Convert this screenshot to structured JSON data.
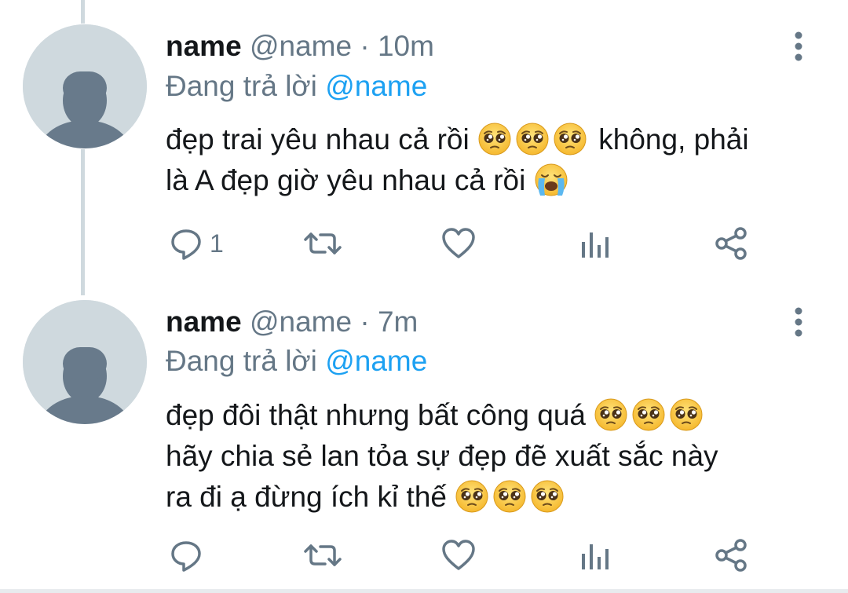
{
  "tweets": [
    {
      "name": "name",
      "handle": "@name",
      "separator": "·",
      "time": "10m",
      "reply_prefix": "Đang trả lời",
      "reply_to": "@name",
      "line1_a": "đẹp trai yêu nhau cả rồi",
      "line1_b": "không, phải",
      "line2": "là A đẹp giờ yêu nhau cả rồi",
      "reply_count": "1"
    },
    {
      "name": "name",
      "handle": "@name",
      "separator": "·",
      "time": "7m",
      "reply_prefix": "Đang trả lời",
      "reply_to": "@name",
      "line1": "đẹp đôi thật nhưng bất công quá",
      "line2": "hãy chia sẻ lan tỏa sự đẹp đẽ xuất sắc này",
      "line3": "ra đi ạ đừng ích kỉ thế",
      "reply_count": ""
    }
  ],
  "icons": {
    "reply": "reply-icon",
    "retweet": "retweet-icon",
    "like": "heart-icon",
    "analytics": "analytics-icon",
    "share": "share-icon",
    "more": "more-vertical-icon",
    "pleading_emoji": "pleading-face-emoji",
    "crying_emoji": "loudly-crying-face-emoji"
  },
  "colors": {
    "name": "#14171a",
    "secondary": "#657786",
    "mention": "#1da1f2",
    "avatar_bg": "#cfd9de",
    "avatar_fg": "#687a8b"
  }
}
